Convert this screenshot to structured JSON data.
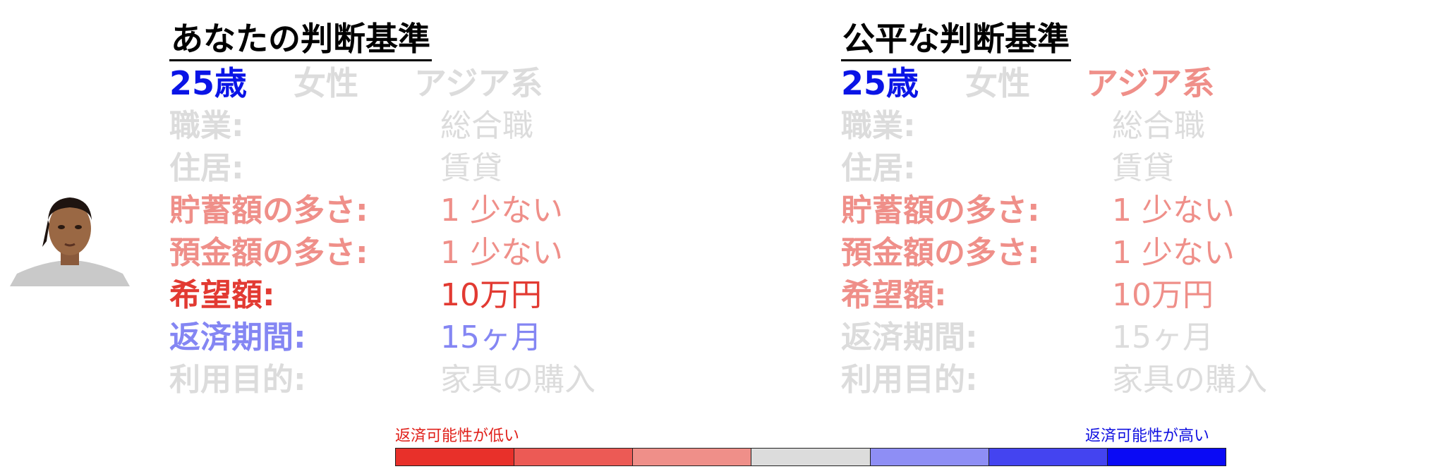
{
  "left_panel": {
    "title": "あなたの判断基準",
    "age": "25歳",
    "gender": "女性",
    "ethnicity": "アジア系",
    "rows": [
      {
        "label": "職業:",
        "value": "総合職"
      },
      {
        "label": "住居:",
        "value": "賃貸"
      },
      {
        "label": "貯蓄額の多さ:",
        "value": "1 少ない"
      },
      {
        "label": "預金額の多さ:",
        "value": "1 少ない"
      },
      {
        "label": "希望額:",
        "value": "10万円"
      },
      {
        "label": "返済期間:",
        "value": "15ヶ月"
      },
      {
        "label": "利用目的:",
        "value": "家具の購入"
      }
    ]
  },
  "right_panel": {
    "title": "公平な判断基準",
    "age": "25歳",
    "gender": "女性",
    "ethnicity": "アジア系",
    "rows": [
      {
        "label": "職業:",
        "value": "総合職"
      },
      {
        "label": "住居:",
        "value": "賃貸"
      },
      {
        "label": "貯蓄額の多さ:",
        "value": "1 少ない"
      },
      {
        "label": "預金額の多さ:",
        "value": "1 少ない"
      },
      {
        "label": "希望額:",
        "value": "10万円"
      },
      {
        "label": "返済期間:",
        "value": "15ヶ月"
      },
      {
        "label": "利用目的:",
        "value": "家具の購入"
      }
    ]
  },
  "legend": {
    "low_label": "返済可能性が低い",
    "high_label": "返済可能性が高い",
    "scale_colors": [
      "#e8302a",
      "#ec5a55",
      "#ef8f89",
      "#dcdcdc",
      "#8e8ef5",
      "#4444f0",
      "#0a0af5"
    ]
  },
  "colors": {
    "gray": "#dcdcdc",
    "blue": "#0a14e6",
    "red_strong": "#e23a32",
    "red_light": "#ef8f89",
    "blue_light": "#8486f3"
  }
}
